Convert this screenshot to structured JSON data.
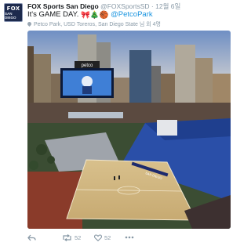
{
  "tweet": {
    "author_name": "FOX Sports San Diego",
    "author_handle": "@FOXSportsSD",
    "separator": "·",
    "date": "12월 6일",
    "text_main": "It's GAME DAY.",
    "emoji": [
      "🎀",
      "🎄",
      "🏀"
    ],
    "mention": "@PetcoPark",
    "location": "Petco Park, USD Toreros, San Diego State 님 외 4명",
    "avatar": {
      "line1": "FOX",
      "line2": "SAN DIEGO"
    },
    "counts": {
      "retweets": "52",
      "likes": "52"
    },
    "colors": {
      "link": "#1b95e0",
      "muted": "#8899a6",
      "avatar_bg": "#1d2a4d"
    },
    "icons": [
      "reply-icon",
      "retweet-icon",
      "like-icon",
      "more-icon",
      "location-pin-icon"
    ]
  },
  "photo": {
    "scoreboard_label": "petco",
    "court_label": "SAN DIEGO"
  }
}
